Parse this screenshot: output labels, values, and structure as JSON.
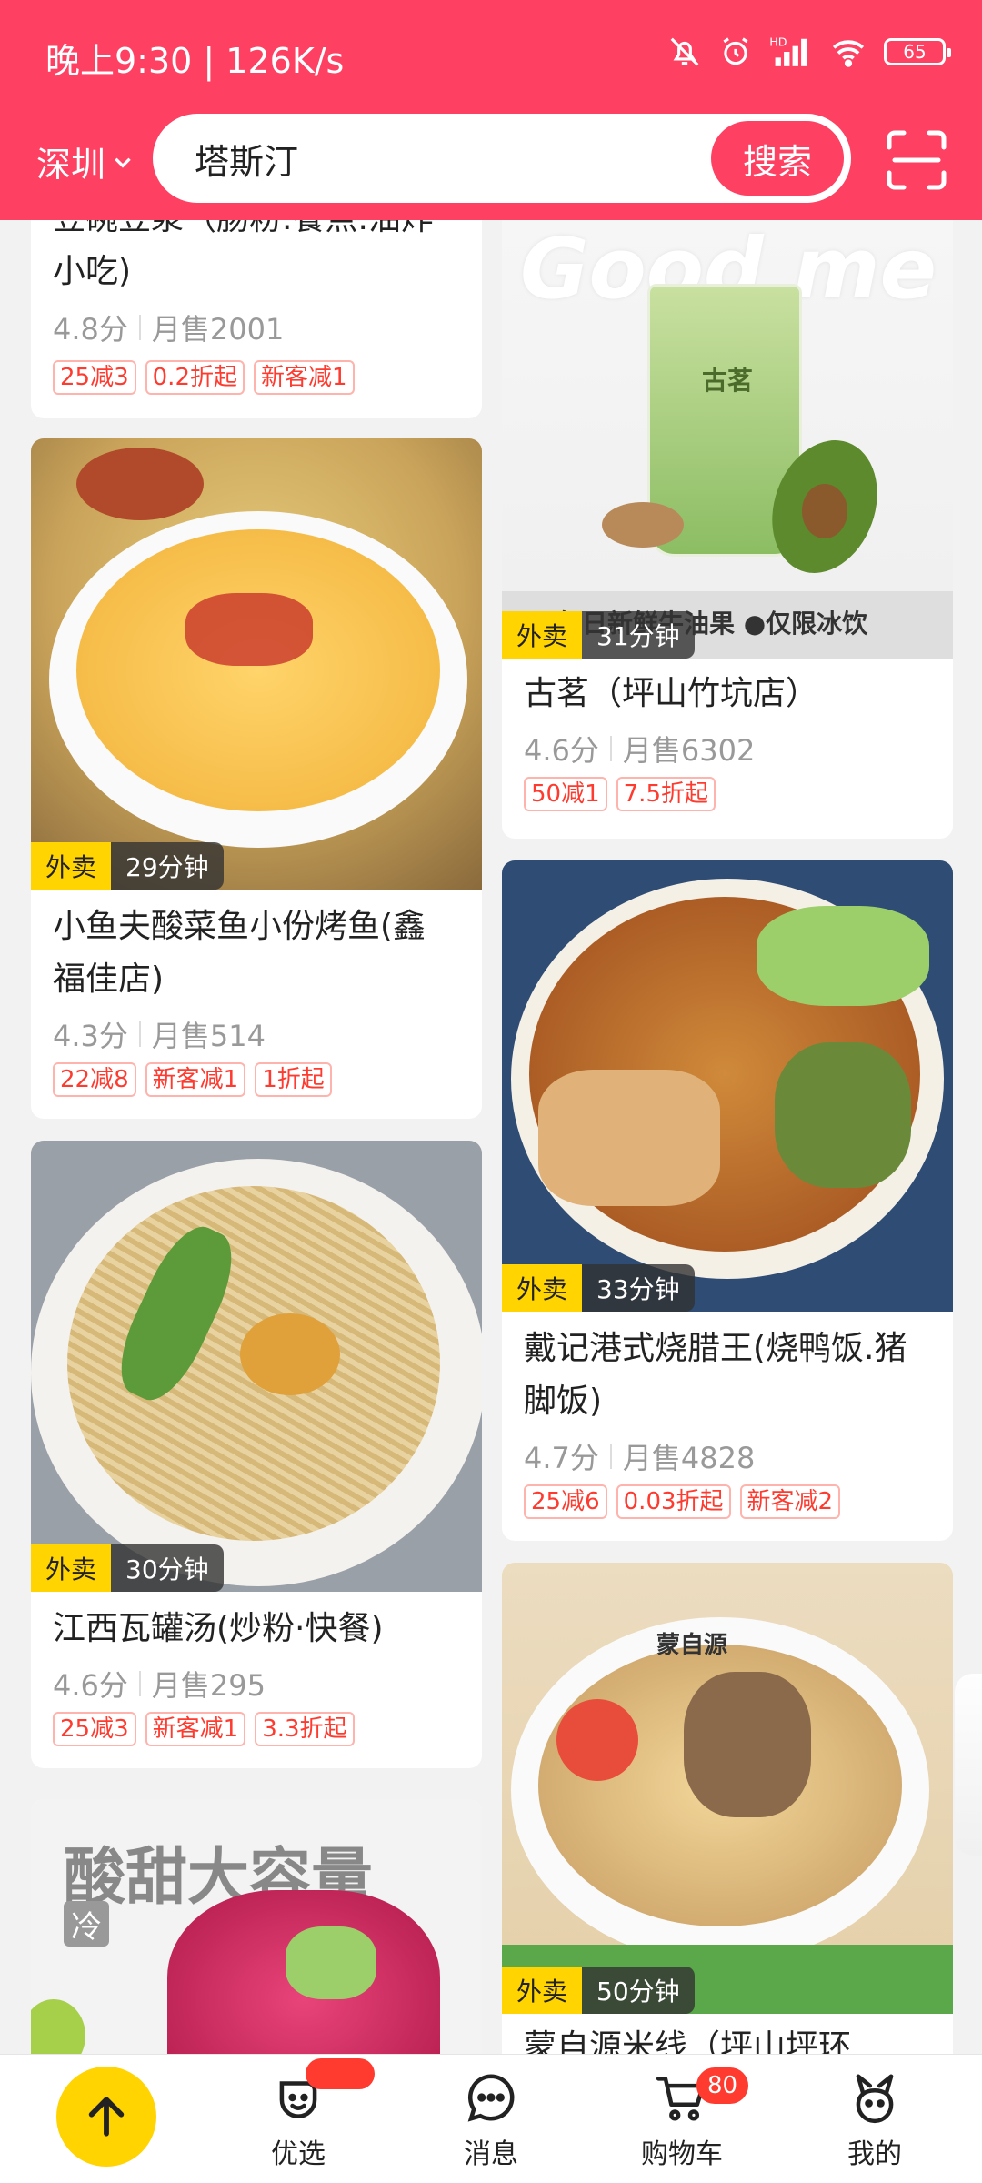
{
  "status_bar": {
    "time": "晚上9:30 | 126K/s",
    "battery": "65"
  },
  "header": {
    "city": "深圳",
    "search_value": "塔斯汀",
    "search_button": "搜索"
  },
  "cards": [
    {
      "name": "豆碗豆浆（肠粉.餐点.油炸小吃)",
      "title_line1": "豆碗豆浆（肠粉.餐点.油炸",
      "title_line2": "小吃)",
      "rating": "4.8分",
      "sales": "月售2001",
      "promos": [
        "25减3",
        "0.2折起",
        "新客减1"
      ]
    },
    {
      "name": "古茗（坪山竹坑店）",
      "rating": "4.6分",
      "sales": "月售6302",
      "promos": [
        "50减1",
        "7.5折起"
      ],
      "tag": "外卖",
      "time": "31分钟",
      "image_text": "Good me",
      "image_caption": "每日新鲜牛油果 ●仅限冰饮",
      "cup_text": "古茗"
    },
    {
      "name": "小鱼夫酸菜鱼小份烤鱼(鑫福佳店)",
      "title_line1": "小鱼夫酸菜鱼小份烤鱼(鑫",
      "title_line2": "福佳店)",
      "rating": "4.3分",
      "sales": "月售514",
      "promos": [
        "22减8",
        "新客减1",
        "1折起"
      ],
      "tag": "外卖",
      "time": "29分钟"
    },
    {
      "name": "戴记港式烧腊王(烧鸭饭.猪脚饭)",
      "title_line1": "戴记港式烧腊王(烧鸭饭.猪",
      "title_line2": "脚饭)",
      "rating": "4.7分",
      "sales": "月售4828",
      "promos": [
        "25减6",
        "0.03折起",
        "新客减2"
      ],
      "tag": "外卖",
      "time": "33分钟"
    },
    {
      "name": "江西瓦罐汤(炒粉·快餐)",
      "rating": "4.6分",
      "sales": "月售295",
      "promos": [
        "25减3",
        "新客减1",
        "3.3折起"
      ],
      "tag": "外卖",
      "time": "30分钟"
    },
    {
      "name": "蒙自源米线（坪山坪环",
      "tag": "外卖",
      "time": "50分钟",
      "bowl_text": "蒙自源"
    },
    {
      "image_text": "酸甜大容量",
      "image_badge": "冷"
    }
  ],
  "nav": {
    "items": [
      "优选",
      "消息",
      "购物车",
      "我的"
    ],
    "cart_badge": "80"
  },
  "icons": [
    "bell-off-icon",
    "alarm-icon",
    "signal-icon",
    "wifi-icon",
    "battery-icon",
    "chevron-down-icon",
    "scan-icon",
    "arrow-up-icon",
    "youxuan-icon",
    "message-icon",
    "cart-icon",
    "profile-icon"
  ],
  "colors": {
    "brand": "#fe4062",
    "accent_yellow": "#ffd400",
    "promo_red": "#ff3a2e"
  }
}
